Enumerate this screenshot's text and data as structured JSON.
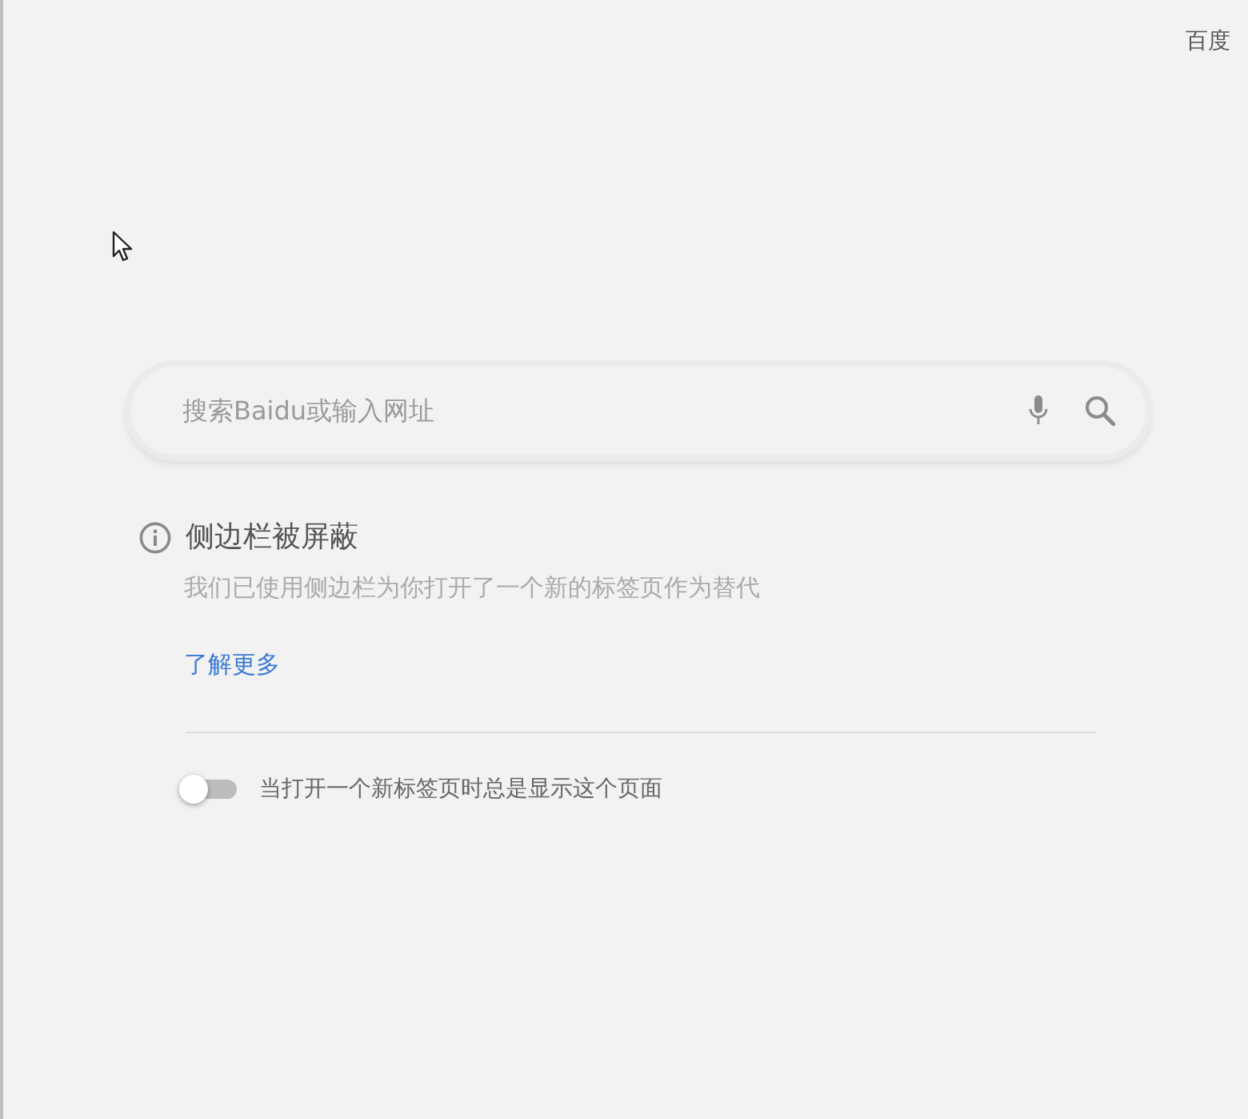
{
  "top_link": "百度",
  "search": {
    "placeholder": "搜索Baidu或输入网址"
  },
  "notice": {
    "title": "侧边栏被屏蔽",
    "message": "我们已使用侧边栏为你打开了一个新的标签页作为替代",
    "link": "了解更多"
  },
  "setting": {
    "label": "当打开一个新标签页时总是显示这个页面",
    "on": false
  }
}
